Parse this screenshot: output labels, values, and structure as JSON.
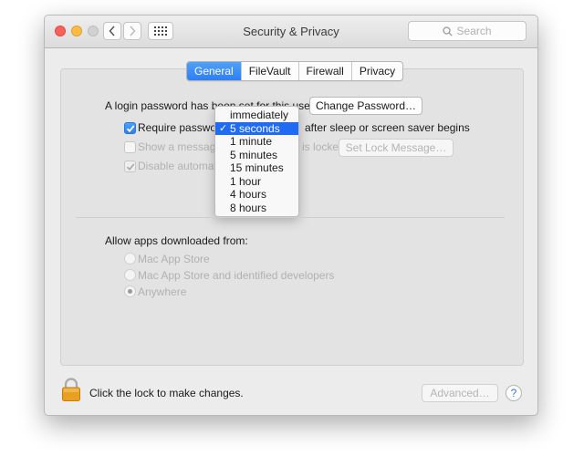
{
  "window": {
    "title": "Security & Privacy"
  },
  "toolbar": {
    "search_placeholder": "Search"
  },
  "tabs": [
    {
      "label": "General",
      "active": true
    },
    {
      "label": "FileVault",
      "active": false
    },
    {
      "label": "Firewall",
      "active": false
    },
    {
      "label": "Privacy",
      "active": false
    }
  ],
  "general": {
    "login_password_text": "A login password has been set for this user",
    "change_password_label": "Change Password…",
    "require_password_label": "Require password",
    "require_password_suffix": "after sleep or screen saver begins",
    "require_password_checked": true,
    "show_message_label": "Show a message when the screen is locked",
    "show_message_visible_start": "Show a message",
    "show_message_visible_end": "is locked",
    "set_lock_message_label": "Set Lock Message…",
    "disable_auto_login_label": "Disable automatic login",
    "disable_auto_login_visible": "Disable automatic",
    "disable_auto_login_checked": true
  },
  "dropdown": {
    "options": [
      "immediately",
      "5 seconds",
      "1 minute",
      "5 minutes",
      "15 minutes",
      "1 hour",
      "4 hours",
      "8 hours"
    ],
    "selected": "5 seconds",
    "checkmark": "✓"
  },
  "downloads": {
    "heading": "Allow apps downloaded from:",
    "options": [
      "Mac App Store",
      "Mac App Store and identified developers",
      "Anywhere"
    ],
    "selected": "Anywhere"
  },
  "footer": {
    "lock_text": "Click the lock to make changes.",
    "advanced_label": "Advanced…",
    "help_label": "?"
  },
  "colors": {
    "accent": "#2d7ff4",
    "selection": "#1f6cf2",
    "lock": "#e8a020"
  },
  "icons": {
    "close": "close-button",
    "minimize": "minimize-button",
    "zoom": "zoom-button",
    "back": "chevron-left-icon",
    "forward": "chevron-right-icon",
    "grid": "grid-icon",
    "search": "search-icon",
    "lock": "lock-icon",
    "help": "help-icon"
  }
}
